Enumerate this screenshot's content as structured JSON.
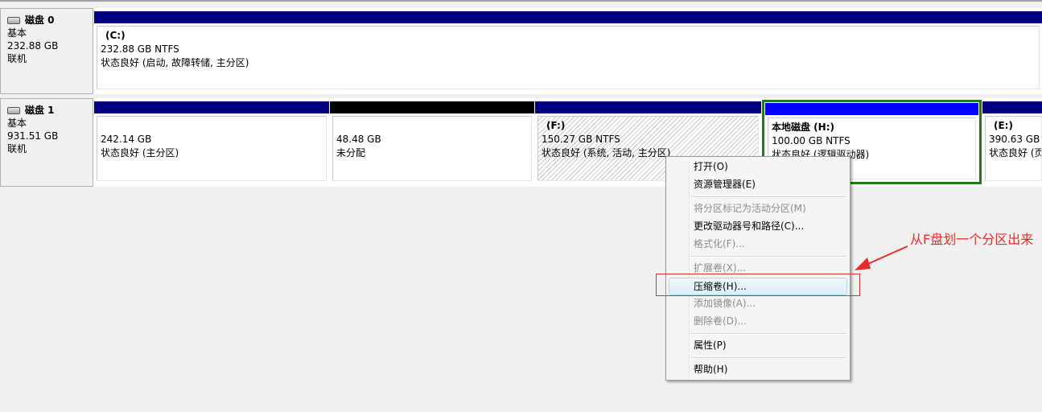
{
  "colors": {
    "primary_bar": "#00007f",
    "unallocated_bar": "#000000",
    "logical_bar": "#0000ff",
    "selected_outline": "#1e7b1e",
    "annotation": "#e42c2c"
  },
  "disk0": {
    "name": "磁盘 0",
    "type": "基本",
    "size": "232.88 GB",
    "status": "联机",
    "partitions": [
      {
        "volume": "(C:)",
        "size": "232.88 GB NTFS",
        "status": "状态良好 (启动, 故障转储, 主分区)"
      }
    ]
  },
  "disk1": {
    "name": "磁盘 1",
    "type": "基本",
    "size": "931.51 GB",
    "status": "联机",
    "partitions": [
      {
        "size": "242.14 GB",
        "status": "状态良好 (主分区)"
      },
      {
        "size": "48.48 GB",
        "status": "未分配"
      },
      {
        "volume": "(F:)",
        "size": "150.27 GB NTFS",
        "status": "状态良好 (系统, 活动, 主分区)"
      },
      {
        "volume": "本地磁盘  (H:)",
        "size": "100.00 GB NTFS",
        "status": "状态良好 (逻辑驱动器)"
      },
      {
        "volume": "(E:)",
        "size": "390.63 GB NTFS",
        "status": "状态良好 (页"
      }
    ]
  },
  "context_menu": {
    "items": [
      {
        "label": "打开(O)",
        "enabled": true
      },
      {
        "label": "资源管理器(E)",
        "enabled": true
      },
      {
        "label": "将分区标记为活动分区(M)",
        "enabled": false
      },
      {
        "label": "更改驱动器号和路径(C)...",
        "enabled": true
      },
      {
        "label": "格式化(F)...",
        "enabled": false
      },
      {
        "label": "扩展卷(X)...",
        "enabled": false
      },
      {
        "label": "压缩卷(H)...",
        "enabled": true
      },
      {
        "label": "添加镜像(A)...",
        "enabled": false
      },
      {
        "label": "删除卷(D)...",
        "enabled": false
      },
      {
        "label": "属性(P)",
        "enabled": true
      },
      {
        "label": "帮助(H)",
        "enabled": true
      }
    ]
  },
  "annotation": {
    "text": "从F盘划一个分区出来"
  }
}
